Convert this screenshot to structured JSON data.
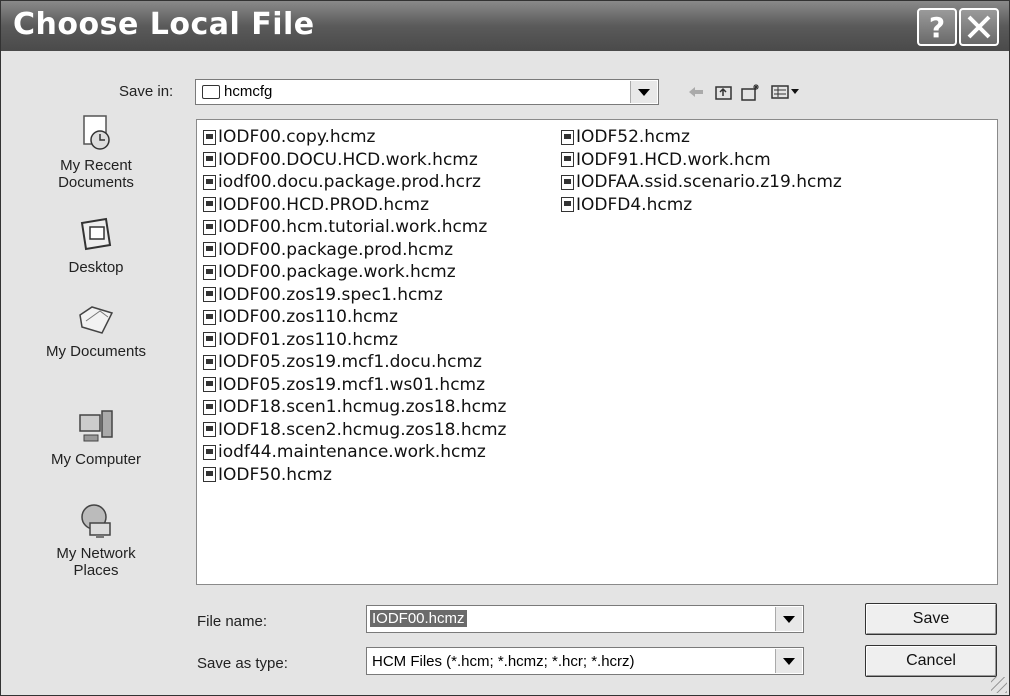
{
  "window": {
    "title": "Choose Local File",
    "help_label": "?"
  },
  "toolbar": {
    "save_in_label": "Save in:",
    "save_in_value": "hcmcfg",
    "icons": [
      "back-arrow-icon",
      "up-folder-icon",
      "new-folder-icon",
      "view-menu-icon"
    ]
  },
  "places": [
    {
      "label_line1": "My Recent",
      "label_line2": "Documents",
      "icon": "recent-documents-icon"
    },
    {
      "label_line1": "Desktop",
      "label_line2": "",
      "icon": "desktop-icon"
    },
    {
      "label_line1": "My Documents",
      "label_line2": "",
      "icon": "my-documents-icon"
    },
    {
      "label_line1": "My Computer",
      "label_line2": "",
      "icon": "my-computer-icon"
    },
    {
      "label_line1": "My Network",
      "label_line2": "Places",
      "icon": "network-places-icon"
    }
  ],
  "files_col1": [
    "IODF00.copy.hcmz",
    "IODF00.DOCU.HCD.work.hcmz",
    "iodf00.docu.package.prod.hcrz",
    "IODF00.HCD.PROD.hcmz",
    "IODF00.hcm.tutorial.work.hcmz",
    "IODF00.package.prod.hcmz",
    "IODF00.package.work.hcmz",
    "IODF00.zos19.spec1.hcmz",
    "IODF00.zos110.hcmz",
    "IODF01.zos110.hcmz",
    "IODF05.zos19.mcf1.docu.hcmz",
    "IODF05.zos19.mcf1.ws01.hcmz",
    "IODF18.scen1.hcmug.zos18.hcmz",
    "IODF18.scen2.hcmug.zos18.hcmz",
    "iodf44.maintenance.work.hcmz",
    "IODF50.hcmz"
  ],
  "files_col2": [
    "IODF52.hcmz",
    "IODF91.HCD.work.hcm",
    "IODFAA.ssid.scenario.z19.hcmz",
    "IODFD4.hcmz"
  ],
  "footer": {
    "file_name_label": "File name:",
    "file_name_value": "IODF00.hcmz",
    "save_as_type_label": "Save as type:",
    "save_as_type_value": "HCM Files (*.hcm; *.hcmz; *.hcr; *.hcrz)",
    "save_button": "Save",
    "cancel_button": "Cancel"
  }
}
